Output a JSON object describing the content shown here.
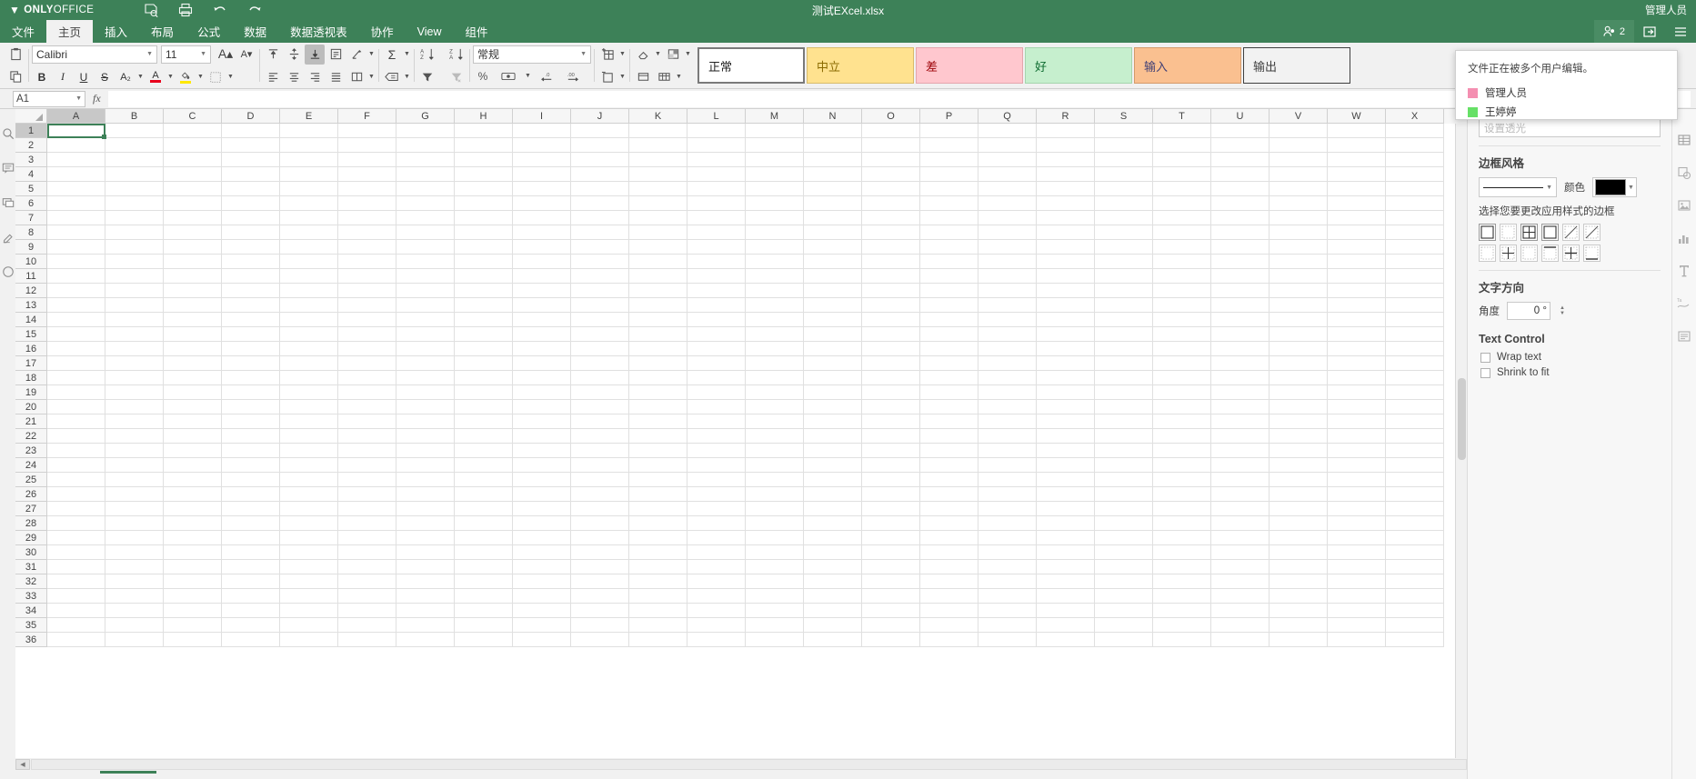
{
  "app": {
    "brand_bold": "ONLY",
    "brand_light": "OFFICE",
    "doc_title": "测试EXcel.xlsx",
    "user_name": "管理人员",
    "accent_green": "#3d8158",
    "toolbar_bg": "#f1f1f1"
  },
  "topbar_icons": [
    {
      "name": "save-icon",
      "label": "保存"
    },
    {
      "name": "print-icon",
      "label": "打印"
    },
    {
      "name": "undo-icon",
      "label": "撤销"
    },
    {
      "name": "redo-icon",
      "label": "重做"
    }
  ],
  "tabs": [
    {
      "label": "文件",
      "active": false
    },
    {
      "label": "主页",
      "active": true
    },
    {
      "label": "插入",
      "active": false
    },
    {
      "label": "布局",
      "active": false
    },
    {
      "label": "公式",
      "active": false
    },
    {
      "label": "数据",
      "active": false
    },
    {
      "label": "数据透视表",
      "active": false
    },
    {
      "label": "协作",
      "active": false
    },
    {
      "label": "View",
      "active": false
    },
    {
      "label": "组件",
      "active": false
    }
  ],
  "tabrow_right": {
    "collaborator_count": "2",
    "share_label": "",
    "menu_label": ""
  },
  "toolbar": {
    "font_name": "Calibri",
    "font_size": "11",
    "number_format": "常规",
    "grow_font_label": "A",
    "shrink_font_label": "A",
    "bold": "B",
    "italic": "I",
    "underline": "U",
    "strike": "S",
    "subscript": "A₂",
    "percent": "%",
    "styles": [
      {
        "label": "正常",
        "bg": "#ffffff",
        "fg": "#222222",
        "border": "#7a7a7a",
        "first": true
      },
      {
        "label": "中立",
        "bg": "#ffe28f",
        "fg": "#8a6a00",
        "border": "#d8bb6a",
        "first": false
      },
      {
        "label": "差",
        "bg": "#ffc7ce",
        "fg": "#9c0006",
        "border": "#e4a5ad",
        "first": false
      },
      {
        "label": "好",
        "bg": "#c6efce",
        "fg": "#0d6b2f",
        "border": "#a5d5ae",
        "first": false
      },
      {
        "label": "输入",
        "bg": "#fac090",
        "fg": "#3f3f76",
        "border": "#d49a6a",
        "first": false
      },
      {
        "label": "输出",
        "bg": "#f2f2f2",
        "fg": "#3f3f3f",
        "border": "#3f3f3f",
        "first": false
      }
    ]
  },
  "formula_bar": {
    "name_box": "A1",
    "fx_label": "fx",
    "formula_value": ""
  },
  "left_rail": [
    {
      "name": "search-icon"
    },
    {
      "name": "comments-icon"
    },
    {
      "name": "chat-icon"
    },
    {
      "name": "review-icon"
    },
    {
      "name": "plugins-icon"
    }
  ],
  "grid": {
    "columns": [
      "A",
      "B",
      "C",
      "D",
      "E",
      "F",
      "G",
      "H",
      "I",
      "J",
      "K",
      "L",
      "M",
      "N",
      "O",
      "P",
      "Q",
      "R",
      "S",
      "T",
      "U",
      "V",
      "W",
      "X"
    ],
    "rows": [
      1,
      2,
      3,
      4,
      5,
      6,
      7,
      8,
      9,
      10,
      11,
      12,
      13,
      14,
      15,
      16,
      17,
      18,
      19,
      20,
      21,
      22,
      23,
      24,
      25,
      26,
      27,
      28,
      29,
      30,
      31,
      32,
      33,
      34,
      35,
      36
    ],
    "active_cell": "A1",
    "active_column": "A",
    "active_row": 1
  },
  "right_panel": {
    "top_field_value": "设置透光",
    "border_style_heading": "边框风格",
    "color_label": "颜色",
    "color_value": "#000000",
    "border_pick_hint": "选择您要更改应用样式的边框",
    "border_buttons_row1": [
      {
        "name": "border-all-icon",
        "active": true
      },
      {
        "name": "border-none-icon",
        "active": false
      },
      {
        "name": "border-inner-icon",
        "active": true
      },
      {
        "name": "border-outer-icon",
        "active": true
      },
      {
        "name": "border-diag-up-icon",
        "active": false
      },
      {
        "name": "border-diag-down-icon",
        "active": false
      }
    ],
    "border_buttons_row2": [
      {
        "name": "border-left-icon",
        "active": false
      },
      {
        "name": "border-inner-vertical-icon",
        "active": false
      },
      {
        "name": "border-right-icon",
        "active": false
      },
      {
        "name": "border-top-icon",
        "active": false
      },
      {
        "name": "border-inner-horizontal-icon",
        "active": false
      },
      {
        "name": "border-bottom-icon",
        "active": false
      }
    ],
    "text_direction_heading": "文字方向",
    "angle_label": "角度",
    "angle_value": "0 °",
    "text_control_heading": "Text Control",
    "wrap_text_label": "Wrap text",
    "wrap_text_checked": false,
    "shrink_to_fit_label": "Shrink to fit",
    "shrink_to_fit_checked": false
  },
  "right_rail": [
    {
      "name": "cell-settings-icon"
    },
    {
      "name": "shape-settings-icon"
    },
    {
      "name": "image-settings-icon"
    },
    {
      "name": "chart-settings-icon"
    },
    {
      "name": "text-art-settings-icon"
    },
    {
      "name": "sparkline-settings-icon"
    },
    {
      "name": "paragraph-settings-icon"
    }
  ],
  "collab_popup": {
    "message": "文件正在被多个用户编辑。",
    "users": [
      {
        "name": "管理人员",
        "color": "#f48fb1"
      },
      {
        "name": "王婷婷",
        "color": "#66e066"
      }
    ]
  }
}
